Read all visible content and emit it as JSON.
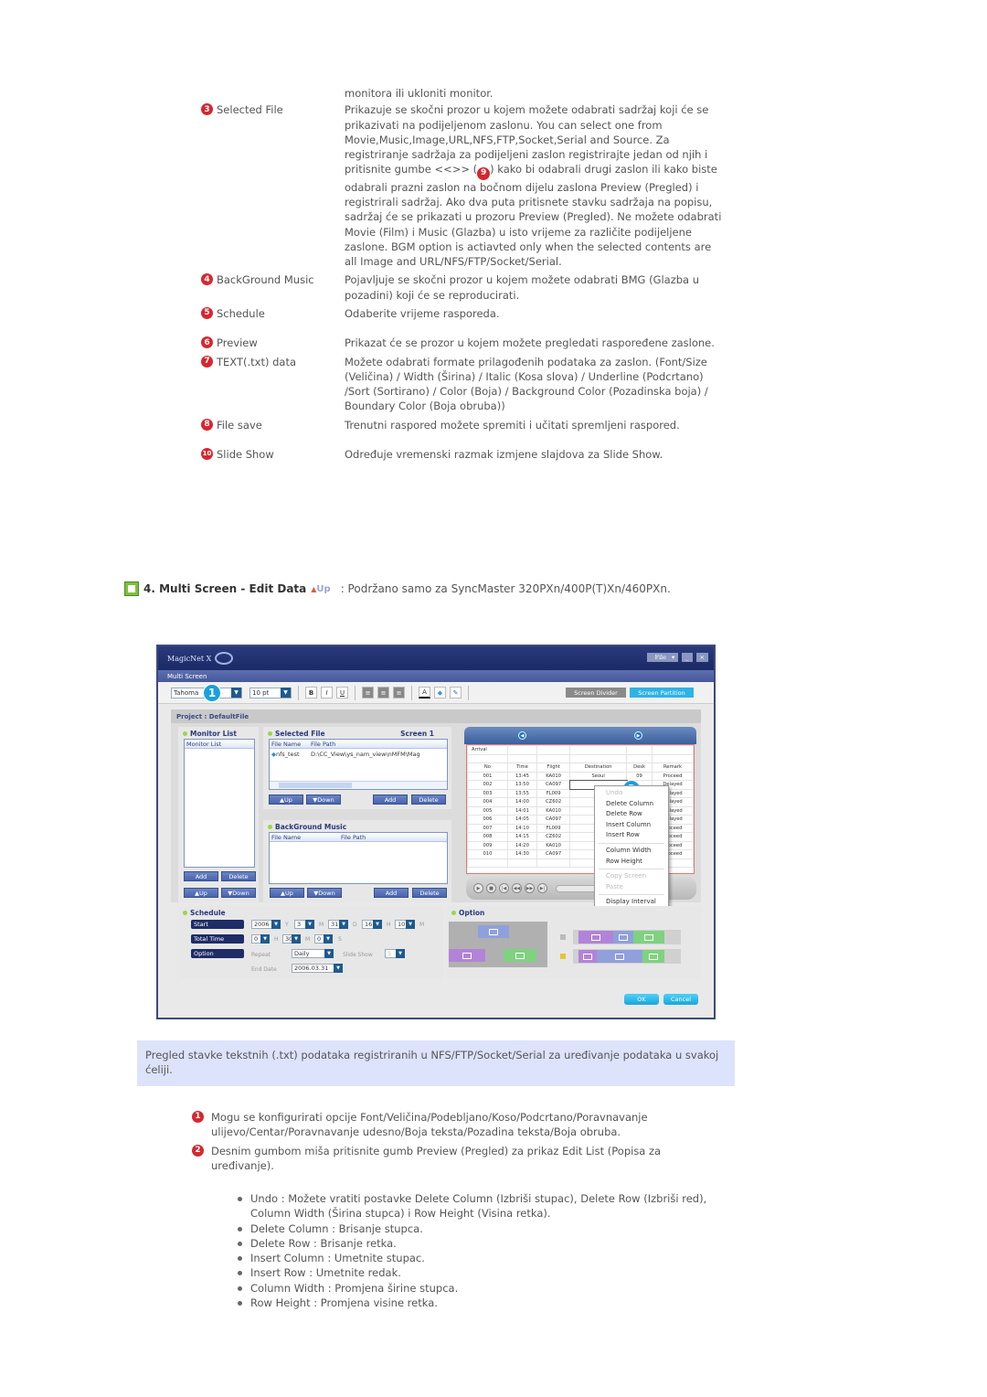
{
  "definitions": [
    {
      "num": "",
      "term": "",
      "desc": "monitora ili ukloniti monitor."
    },
    {
      "num": "3",
      "term": "Selected File",
      "desc": "Prikazuje se skočni prozor u kojem možete odabrati sadržaj koji će se prikazivati na podijeljenom zaslonu. You can select one from Movie,Music,Image,URL,NFS,FTP,Socket,Serial and Source. Za registriranje sadržaja za podijeljeni zaslon registrirajte jedan od njih i pritisnite gumbe <<>> (",
      "desc_badge": "9",
      "desc_after": ") kako bi odabrali drugi zaslon ili kako biste odabrali prazni zaslon na bočnom dijelu zaslona Preview (Pregled) i registrirali sadržaj. Ako dva puta pritisnete stavku sadržaja na popisu, sadržaj će se prikazati u prozoru Preview (Pregled). Ne možete odabrati Movie (Film) i Music (Glazba) u isto vrijeme za različite podijeljene zaslone. BGM option is actiavted only when the selected contents are all Image and URL/NFS/FTP/Socket/Serial."
    },
    {
      "num": "4",
      "term": "BackGround Music",
      "desc": "Pojavljuje se skočni prozor u kojem možete odabrati BMG (Glazba u pozadini) koji će se reproducirati."
    },
    {
      "num": "5",
      "term": "Schedule",
      "desc": "Odaberite vrijeme rasporeda."
    },
    {
      "num": "6",
      "term": "Preview",
      "desc": "Prikazat će se prozor u kojem možete pregledati raspoređene zaslone."
    },
    {
      "num": "7",
      "term": "TEXT(.txt) data",
      "desc": "Možete odabrati formate prilagođenih podataka za zaslon. (Font/Size (Veličina) / Width (Širina) / Italic (Kosa slova) / Underline (Podcrtano) /Sort (Sortirano) / Color (Boja) / Background Color (Pozadinska boja) / Boundary Color (Boja obruba))"
    },
    {
      "num": "8",
      "term": "File save",
      "desc": "Trenutni raspored možete spremiti i učitati spremljeni raspored."
    },
    {
      "num": "10",
      "term": "Slide Show",
      "desc": "Određuje vremenski razmak izmjene slajdova za Slide Show."
    }
  ],
  "section": {
    "title": "4. Multi Screen - Edit Data",
    "up_label": "Up",
    "note": ": Podržano samo za SyncMaster 320PXn/400P(T)Xn/460PXn."
  },
  "app": {
    "brand": "MagicNet X",
    "file_menu": "File",
    "subtitle": "Multi Screen",
    "font": "Tahoma",
    "size": "10 pt",
    "bold": "B",
    "italic": "I",
    "underline": "U",
    "callout_1": "1",
    "callout_2": "2",
    "screen_divider": "Screen Divider",
    "screen_partition": "Screen Partition",
    "project": "Project : DefaultFile",
    "monitor_list": {
      "title": "Monitor List",
      "header": "Monitor List",
      "add": "Add",
      "delete": "Delete",
      "up": "Up",
      "down": "Down"
    },
    "selected_file": {
      "title": "Selected File",
      "screen": "Screen 1",
      "col_name": "File Name",
      "col_path": "File Path",
      "row_name": "nfs_test",
      "row_path": "D:\\CC_View\\ys_nam_view\\nMFM\\Mag",
      "up": "Up",
      "down": "Down",
      "add": "Add",
      "delete": "Delete"
    },
    "bgm": {
      "title": "BackGround Music",
      "col_name": "File Name",
      "col_path": "File Path",
      "up": "Up",
      "down": "Down",
      "add": "Add",
      "delete": "Delete"
    },
    "grid": {
      "title": "Arrival",
      "headers": [
        "No",
        "Time",
        "Flight",
        "Destination",
        "Desk",
        "Remark"
      ],
      "rows": [
        [
          "001",
          "13:45",
          "KA010",
          "Seoul",
          "09",
          "Proceed"
        ],
        [
          "002",
          "13:50",
          "CA097",
          "",
          "",
          "Delayed"
        ],
        [
          "003",
          "13:55",
          "FL009",
          "L",
          "",
          "Delayed"
        ],
        [
          "004",
          "14:00",
          "CZ602",
          "Ne",
          "",
          "Delayed"
        ],
        [
          "005",
          "14:01",
          "KA010",
          "Los",
          "",
          "Delayed"
        ],
        [
          "006",
          "14:05",
          "CA097",
          "",
          "",
          "Delayed"
        ],
        [
          "007",
          "14:10",
          "FL009",
          "Bu",
          "",
          "Proceed"
        ],
        [
          "008",
          "14:15",
          "CZ602",
          "Fr",
          "",
          "Proceed"
        ],
        [
          "009",
          "14:20",
          "KA010",
          "Sa",
          "",
          "Proceed"
        ],
        [
          "010",
          "14:30",
          "CA097",
          "Wa",
          "",
          "Proceed"
        ]
      ]
    },
    "context_menu": {
      "items": [
        "Undo",
        "Delete Column",
        "Delete Row",
        "Insert Column",
        "Insert Row",
        "Column Width",
        "Row Height",
        "Copy Screen",
        "Paste",
        "Display Interval"
      ]
    },
    "schedule": {
      "title": "Schedule",
      "start_label": "Start",
      "total_label": "Total Time",
      "option_label": "Option",
      "year": "2006",
      "y": "Y",
      "month": "3",
      "m": "M",
      "day": "31",
      "d": "D",
      "hour": "16",
      "h": "H",
      "minute": "10",
      "mi": "M",
      "tt_h": "0",
      "tt_m": "30",
      "tt_s": "0",
      "s": "S",
      "repeat_label": "Repeat",
      "repeat": "Daily",
      "slideshow_label": "Slide Show",
      "slideshow": "5",
      "end_label": "End Date",
      "end_date": "2006.03.31"
    },
    "option": {
      "title": "Option"
    },
    "ok": "OK",
    "cancel": "Cancel"
  },
  "info": "Pregled stavke tekstnih (.txt) podataka registriranih u NFS/FTP/Socket/Serial za uređivanje podataka u svakoj ćeliji.",
  "notes": [
    {
      "num": "1",
      "text": "Mogu se konfigurirati opcije Font/Veličina/Podebljano/Koso/Podcrtano/Poravnavanje ulijevo/Centar/Poravnavanje udesno/Boja teksta/Pozadina teksta/Boja obruba."
    },
    {
      "num": "2",
      "text": "Desnim gumbom miša pritisnite gumb Preview (Pregled) za prikaz Edit List (Popisa za uređivanje)."
    }
  ],
  "bullets": [
    "Undo : Možete vratiti postavke Delete Column (Izbriši stupac), Delete Row (Izbriši red), Column Width (Širina stupca) i Row Height (Visina retka).",
    "Delete Column : Brisanje stupca.",
    "Delete Row : Brisanje retka.",
    "Insert Column : Umetnite stupac.",
    "Insert Row : Umetnite redak.",
    "Column Width : Promjena širine stupca.",
    "Row Height : Promjena visine retka."
  ],
  "colors": {
    "badge": "#d8262f",
    "info_bg": "#dde3fb",
    "accent": "#19a1d8"
  }
}
